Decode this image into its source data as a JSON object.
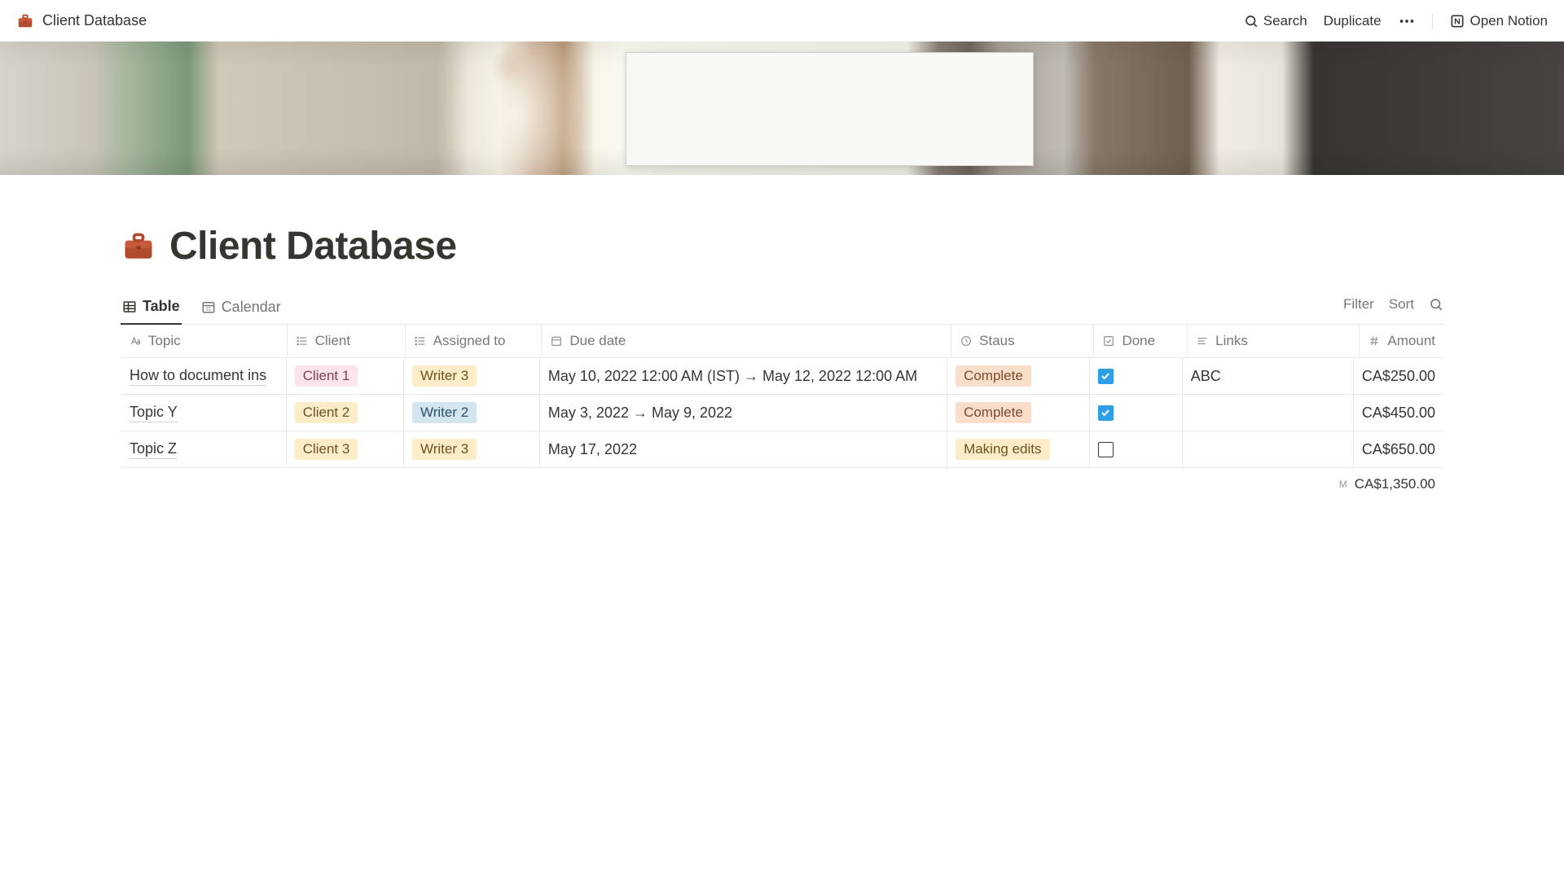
{
  "topbar": {
    "title": "Client Database",
    "search": "Search",
    "duplicate": "Duplicate",
    "open_notion": "Open Notion"
  },
  "page": {
    "title": "Client Database"
  },
  "views": {
    "table": "Table",
    "calendar": "Calendar",
    "filter": "Filter",
    "sort": "Sort"
  },
  "columns": {
    "topic": "Topic",
    "client": "Client",
    "assigned": "Assigned to",
    "due": "Due date",
    "status": "Staus",
    "done": "Done",
    "links": "Links",
    "amount": "Amount"
  },
  "rows": [
    {
      "topic": "How to document ins",
      "client": {
        "label": "Client 1",
        "color": "pink"
      },
      "assigned": {
        "label": "Writer 3",
        "color": "yellow"
      },
      "due": "May 10, 2022 12:00 AM (IST) → May 12, 2022 12:00 AM",
      "status": {
        "label": "Complete",
        "color": "salmon"
      },
      "done": true,
      "links": "ABC",
      "amount": "CA$250.00"
    },
    {
      "topic": "Topic Y",
      "client": {
        "label": "Client 2",
        "color": "yellow"
      },
      "assigned": {
        "label": "Writer 2",
        "color": "blue"
      },
      "due": "May 3, 2022 → May 9, 2022",
      "status": {
        "label": "Complete",
        "color": "salmon"
      },
      "done": true,
      "links": "",
      "amount": "CA$450.00"
    },
    {
      "topic": "Topic Z",
      "client": {
        "label": "Client 3",
        "color": "yellow"
      },
      "assigned": {
        "label": "Writer 3",
        "color": "yellow"
      },
      "due": "May 17, 2022",
      "status": {
        "label": "Making edits",
        "color": "yellow"
      },
      "done": false,
      "links": "",
      "amount": "CA$650.00"
    }
  ],
  "sum": {
    "label": "M",
    "value": "CA$1,350.00"
  }
}
